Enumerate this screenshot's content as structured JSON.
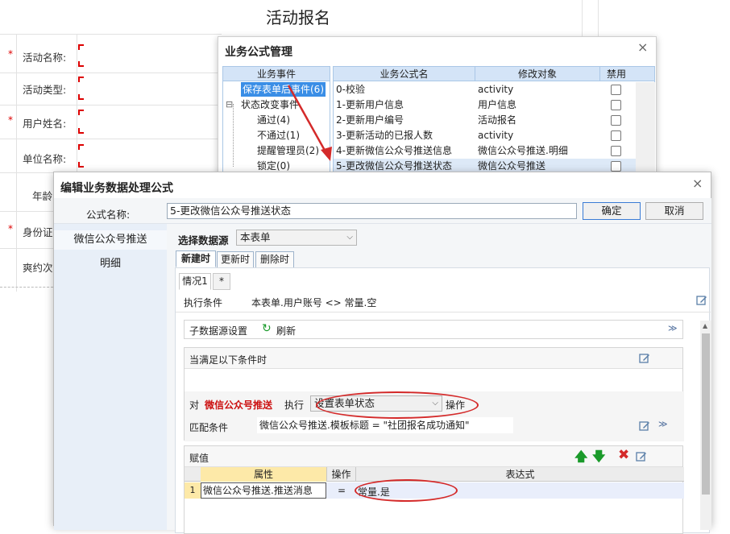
{
  "background_form": {
    "title": "活动报名",
    "required_mark": "*",
    "fields": [
      {
        "label": "活动名称:",
        "required": true
      },
      {
        "label": "活动类型:",
        "required": false
      },
      {
        "label": "用户姓名:",
        "required": true
      },
      {
        "label": "单位名称:",
        "required": false
      },
      {
        "label": "年龄",
        "required": false
      },
      {
        "label": "身份证",
        "required": true
      },
      {
        "label": "爽约次",
        "required": false
      }
    ]
  },
  "formula_manager": {
    "title": "业务公式管理",
    "close_glyph": "×",
    "tree_header": "业务事件",
    "tree": [
      {
        "label": "保存表单后事件(6)",
        "selected": true
      },
      {
        "label": "状态改变事件",
        "expand": "⊟"
      },
      {
        "label": "通过(4)"
      },
      {
        "label": "不通过(1)"
      },
      {
        "label": "提醒管理员(2)"
      },
      {
        "label": "锁定(0)"
      }
    ],
    "columns": [
      "业务公式名",
      "修改对象",
      "禁用"
    ],
    "rows": [
      {
        "name": "0-校验",
        "target": "activity"
      },
      {
        "name": "1-更新用户信息",
        "target": "用户信息"
      },
      {
        "name": "2-更新用户编号",
        "target": "活动报名"
      },
      {
        "name": "3-更新活动的已报人数",
        "target": "activity"
      },
      {
        "name": "4-更新微信公众号推送信息",
        "target": "微信公众号推送.明细"
      },
      {
        "name": "5-更改微信公众号推送状态",
        "target": "微信公众号推送",
        "selected": true
      }
    ]
  },
  "edit_dialog": {
    "title": "编辑业务数据处理公式",
    "close_glyph": "×",
    "formula_name_label": "公式名称:",
    "formula_name_value": "5-更改微信公众号推送状态",
    "ok_label": "确定",
    "cancel_label": "取消",
    "left_items": [
      "微信公众号推送",
      "明细"
    ],
    "datasource_label": "选择数据源",
    "datasource_value": "本表单",
    "tabs": [
      "新建时",
      "更新时",
      "删除时"
    ],
    "case_tabs": [
      "情况1",
      "*"
    ],
    "exec_condition_label": "执行条件",
    "exec_condition_value": "本表单.用户账号 <> 常量.空",
    "sub_datasource_label": "子数据源设置",
    "refresh_label": "刷新",
    "when_label": "当满足以下条件时",
    "for_label": "对",
    "target_name": "微信公众号推送",
    "exec_label": "执行",
    "action_value": "设置表单状态",
    "operation_label": "操作",
    "match_label": "匹配条件",
    "match_value": "微信公众号推送.模板标题 = \"社团报名成功通知\"",
    "assign_label": "赋值",
    "assign_columns": [
      "属性",
      "操作",
      "表达式"
    ],
    "assign_rows": [
      {
        "index": "1",
        "property": "微信公众号推送.推送消息",
        "op": "=",
        "expr": "常量.是"
      }
    ]
  },
  "colors": {
    "accent": "#3a8ee6",
    "annotation_red": "#d42a2a",
    "required_red": "#d00000",
    "header_blue": "#d4e4f7",
    "green_arrow": "#1a9a2a"
  }
}
